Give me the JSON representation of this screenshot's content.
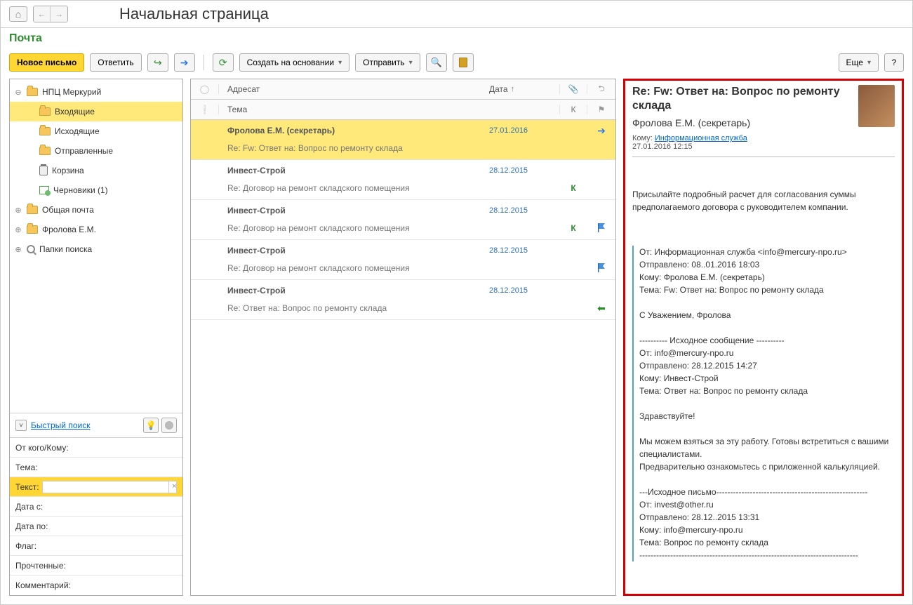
{
  "header": {
    "page_title": "Начальная страница"
  },
  "section": {
    "title": "Почта"
  },
  "toolbar": {
    "new_message": "Новое письмо",
    "reply": "Ответить",
    "create_from": "Создать на основании",
    "send": "Отправить",
    "more": "Еще"
  },
  "tree": {
    "root": "НПЦ Меркурий",
    "inbox": "Входящие",
    "outbox": "Исходящие",
    "sent": "Отправленные",
    "trash": "Корзина",
    "drafts": "Черновики (1)",
    "shared": "Общая почта",
    "frolova": "Фролова Е.М.",
    "search_folders": "Папки поиска"
  },
  "quick_search": {
    "label": "Быстрый поиск"
  },
  "filters": {
    "from_to": "От кого/Кому:",
    "theme": "Тема:",
    "text": "Текст:",
    "date_from": "Дата с:",
    "date_to": "Дата по:",
    "flag": "Флаг:",
    "read": "Прочтенные:",
    "comment": "Комментарий:"
  },
  "grid_headers": {
    "addressee": "Адресат",
    "date": "Дата",
    "theme": "Тема",
    "k": "К"
  },
  "messages": [
    {
      "sender": "Фролова Е.М. (секретарь)",
      "subject": "Re: Fw: Ответ на: Вопрос по ремонту склада",
      "date": "27.01.2016",
      "k": "",
      "flag": "right",
      "selected": true
    },
    {
      "sender": "Инвест-Строй",
      "subject": "Re: Договор на ремонт складского помещения",
      "date": "28.12.2015",
      "k": "К",
      "flag": ""
    },
    {
      "sender": "Инвест-Строй",
      "subject": "Re: Договор на ремонт складского помещения",
      "date": "28.12.2015",
      "k": "К",
      "flag": "blue"
    },
    {
      "sender": "Инвест-Строй",
      "subject": "Re: Договор на ремонт складского помещения",
      "date": "28.12.2015",
      "k": "",
      "flag": "blue"
    },
    {
      "sender": "Инвест-Строй",
      "subject": "Re: Ответ на: Вопрос по ремонту склада",
      "date": "28.12.2015",
      "k": "",
      "flag": "green"
    }
  ],
  "preview": {
    "subject": "Re: Fw: Ответ на: Вопрос по ремонту склада",
    "from": "Фролова Е.М. (секретарь)",
    "to_label": "Кому:",
    "to_link": "Информационная служба",
    "datetime": "27.01.2016 12:15",
    "body": "Присылайте подробный расчет для согласования суммы предполагаемого договора с руководителем компании.",
    "quote1": "От: Информационная служба <info@mercury-npo.ru>\nОтправлено: 08..01.2016 18:03\nКому: Фролова Е.М. (секретарь)\nТема: Fw: Ответ на: Вопрос по ремонту склада\n\nС Уважением, Фролова\n\n---------- Исходное сообщение ----------\nОт: info@mercury-npo.ru\nОтправлено: 28.12.2015 14:27\nКому: Инвест-Строй\nТема: Ответ на: Вопрос по ремонту склада\n\nЗдравствуйте!\n\nМы можем взяться за эту работу. Готовы встретиться с вашими специалистами.\nПредварительно ознакомьтесь с приложенной калькуляцией.\n\n---Исходное письмо------------------------------------------------------\nОт: invest@other.ru\nОтправлено: 28.12..2015 13:31\nКому: info@mercury-npo.ru\nТема: Вопрос по ремонту склада\n------------------------------------------------------------------------------"
  }
}
